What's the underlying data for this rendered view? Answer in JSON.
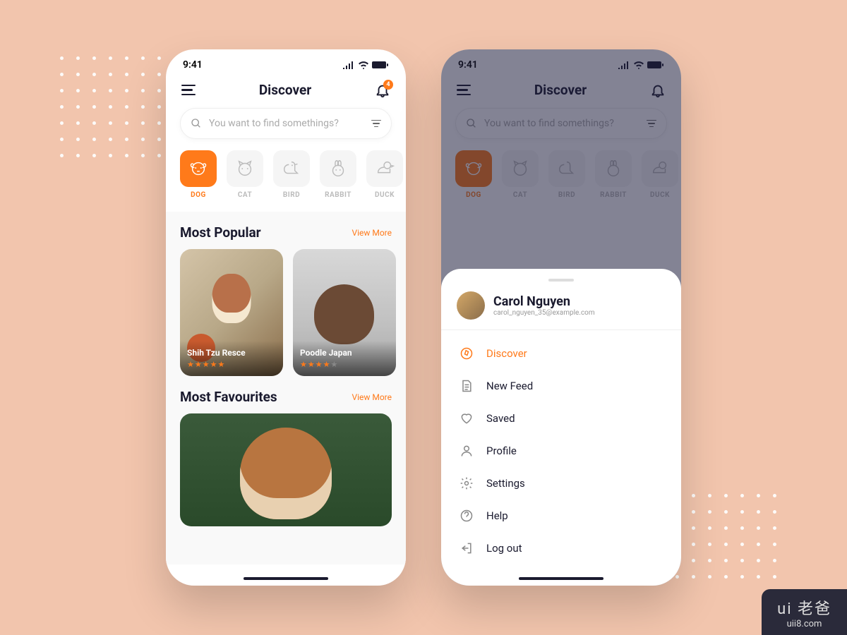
{
  "statusbar": {
    "time": "9:41"
  },
  "header": {
    "title": "Discover",
    "notification_count": "4"
  },
  "search": {
    "placeholder": "You want to find somethings?"
  },
  "categories": [
    {
      "label": "DOG",
      "active": true
    },
    {
      "label": "CAT",
      "active": false
    },
    {
      "label": "BIRD",
      "active": false
    },
    {
      "label": "RABBIT",
      "active": false
    },
    {
      "label": "DUCK",
      "active": false
    }
  ],
  "sections": {
    "popular": {
      "title": "Most Popular",
      "viewmore": "View More",
      "cards": [
        {
          "name": "Shih Tzu Resce",
          "rating": 5
        },
        {
          "name": "Poodle Japan",
          "rating": 4
        }
      ]
    },
    "favourites": {
      "title": "Most Favourites",
      "viewmore": "View More"
    }
  },
  "sheet": {
    "user": {
      "name": "Carol Nguyen",
      "email": "carol_nguyen_35@example.com"
    },
    "menu": [
      {
        "label": "Discover",
        "icon": "compass",
        "active": true
      },
      {
        "label": "New Feed",
        "icon": "document",
        "active": false
      },
      {
        "label": "Saved",
        "icon": "heart",
        "active": false
      },
      {
        "label": "Profile",
        "icon": "person",
        "active": false
      },
      {
        "label": "Settings",
        "icon": "gear",
        "active": false
      },
      {
        "label": "Help",
        "icon": "help",
        "active": false
      },
      {
        "label": "Log out",
        "icon": "logout",
        "active": false
      }
    ]
  },
  "watermark": {
    "brand": "ui 老爸",
    "url": "uii8.com"
  },
  "colors": {
    "accent": "#ff7a1a",
    "text": "#1a1a2e"
  }
}
